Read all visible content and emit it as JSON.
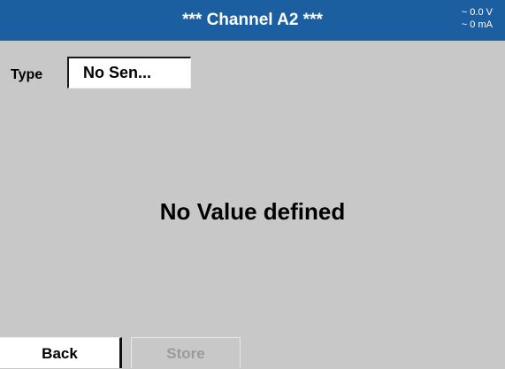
{
  "header": {
    "title": "***  Channel A2  ***",
    "voltage": "~ 0.0 V",
    "current": "~ 0 mA"
  },
  "type": {
    "label": "Type",
    "value": "No Sen..."
  },
  "main": {
    "message": "No Value defined"
  },
  "buttons": {
    "back": "Back",
    "store": "Store"
  },
  "colors": {
    "titlebar": "#1c5fa0",
    "background": "#c8c8c8",
    "store_disabled_text": "#9a9a9a"
  }
}
